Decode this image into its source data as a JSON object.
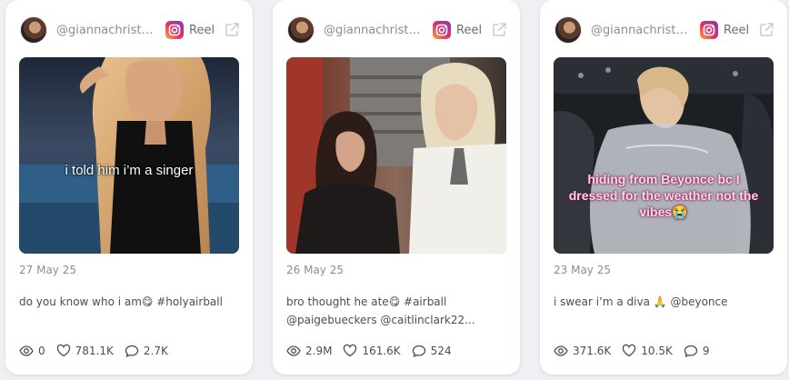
{
  "brand_colors": {
    "card_background": "#ffffff",
    "page_background": "#eef0f4",
    "muted_text": "#8a8d98",
    "body_text": "#4a4d57",
    "overlay_pink": "#ffd3ea"
  },
  "cards": [
    {
      "username": "@giannachristii...",
      "platform_icon": "instagram-icon",
      "platform_label": "Reel",
      "external_icon": "external-link-icon",
      "media_overlay_text": "i told him i’m a singer",
      "date": "27 May 25",
      "caption_line1": "do you know who i am😋 #holyairball",
      "caption_line2": "",
      "views": "0",
      "likes": "781.1K",
      "comments": "2.7K"
    },
    {
      "username": "@giannachristii...",
      "platform_icon": "instagram-icon",
      "platform_label": "Reel",
      "external_icon": "external-link-icon",
      "media_overlay_text": "",
      "date": "26 May 25",
      "caption_line1": "bro thought he ate😋 #airball",
      "caption_line2": "@paigebueckers @caitlinclark22...",
      "views": "2.9M",
      "likes": "161.6K",
      "comments": "524"
    },
    {
      "username": "@giannachristii...",
      "platform_icon": "instagram-icon",
      "platform_label": "Reel",
      "external_icon": "external-link-icon",
      "media_overlay_text": "hiding from Beyonce bc I dressed for the weather not the vibes😭",
      "date": "23 May 25",
      "caption_line1": "i swear i’m a diva 🙏 @beyonce",
      "caption_line2": "",
      "views": "371.6K",
      "likes": "10.5K",
      "comments": "9"
    }
  ]
}
